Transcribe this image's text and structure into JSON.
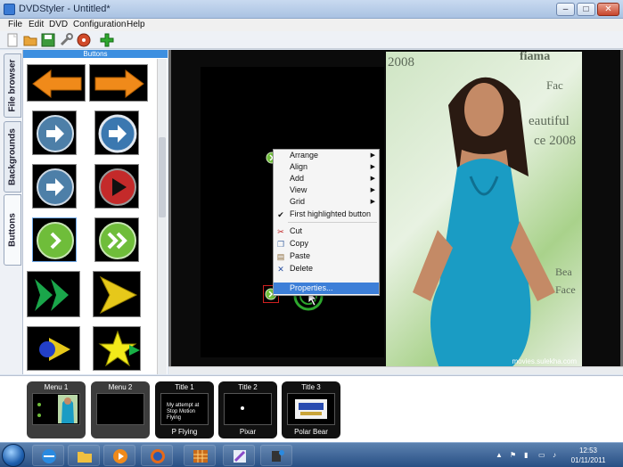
{
  "window": {
    "title": "DVDStyler - Untitled*"
  },
  "menubar": [
    "File",
    "Edit",
    "DVD",
    "Configuration",
    "Help"
  ],
  "toolbar": [
    "new-icon",
    "open-icon",
    "save-icon",
    "settings-icon",
    "burn-icon",
    "add-icon"
  ],
  "tabs": {
    "file_browser": "File browser",
    "backgrounds": "Backgrounds",
    "buttons": "Buttons"
  },
  "buttons_panel": {
    "header": "Buttons"
  },
  "canvas": {
    "caption1": "fiama",
    "caption2": "2008",
    "caption3": "Fac",
    "caption4": "eautiful",
    "caption5": "ce 2008",
    "caption6": "Bea",
    "caption7": "Face",
    "watermark": "movies.sulekha.com"
  },
  "context_menu": {
    "items": [
      {
        "label": "Arrange",
        "submenu": true
      },
      {
        "label": "Align",
        "submenu": true
      },
      {
        "label": "Add",
        "submenu": true
      },
      {
        "label": "View",
        "submenu": true
      },
      {
        "label": "Grid",
        "submenu": true
      },
      {
        "label": "First highlighted button",
        "checked": true
      },
      {
        "label": "Cut"
      },
      {
        "label": "Copy"
      },
      {
        "label": "Paste"
      },
      {
        "label": "Delete"
      },
      {
        "label": "Properties..."
      }
    ]
  },
  "menus": [
    {
      "title": "Menu 1",
      "subtitle": ""
    },
    {
      "title": "Menu 2",
      "subtitle": ""
    },
    {
      "title": "Title 1",
      "subtitle": "P Flying",
      "screen_text": "My attempt at Stop Motion Flying"
    },
    {
      "title": "Title 2",
      "subtitle": "Pixar"
    },
    {
      "title": "Title 3",
      "subtitle": "Polar Bear"
    }
  ],
  "taskbar": {
    "time": "12:53",
    "date": "01/11/2011"
  },
  "colors": {
    "accent": "#3d8fe0",
    "highlight": "#3d7fd8"
  }
}
